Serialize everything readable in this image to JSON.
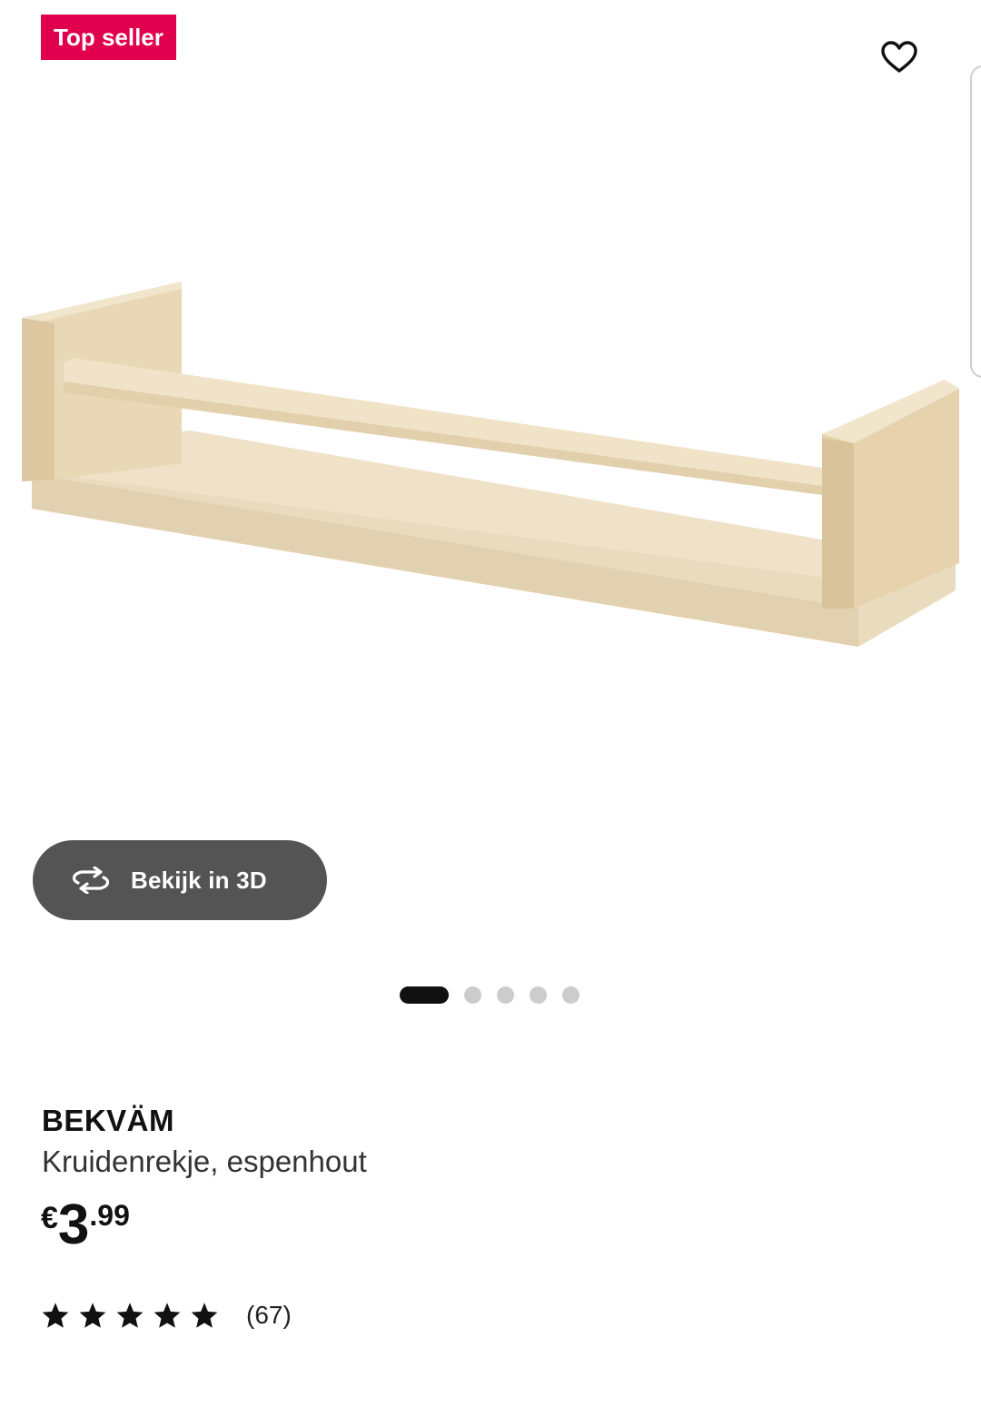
{
  "badge": {
    "text": "Top seller",
    "color": "#e0004d"
  },
  "favorite": {
    "icon": "heart-outline-icon"
  },
  "media": {
    "image_alt": "BEKVÄM spice rack product image",
    "view_3d_label": "Bekijk in 3D",
    "view_3d_icon": "rotate-3d-icon",
    "carousel": {
      "total": 5,
      "active_index": 0
    }
  },
  "product": {
    "name": "BEKVÄM",
    "description": "Kruidenrekje, espenhout",
    "price": {
      "currency": "€",
      "integer": "3",
      "decimal": ".99"
    },
    "rating": {
      "stars": 5,
      "count_label": "(67)"
    }
  },
  "colors": {
    "text": "#111111",
    "button_3d": "#545454",
    "dot_inactive": "#cccccc"
  }
}
